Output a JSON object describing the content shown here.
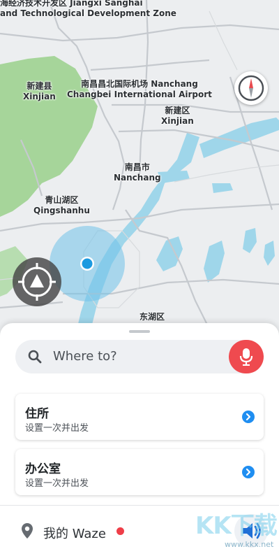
{
  "map": {
    "labels": {
      "zone_cn": "海经济技术开发区 Jiangxi Sanghai",
      "zone_en": "and Technological Development Zone",
      "xinjian_county_cn": "新建县",
      "xinjian_county_en": "Xinjian",
      "airport_cn": "南昌昌北国际机场 Nanchang",
      "airport_en": "Changbei International Airport",
      "xinjian_district_cn": "新建区",
      "xinjian_district_en": "Xinjian",
      "nanchang_cn": "南昌市",
      "nanchang_en": "Nanchang",
      "qingshanhu_cn": "青山湖区",
      "qingshanhu_en": "Qingshanhu",
      "donghu_cn": "东湖区"
    },
    "icons": {
      "compass": "compass-icon",
      "recenter": "recenter-icon"
    }
  },
  "sheet": {
    "search_placeholder": "Where to?",
    "cards": [
      {
        "title": "住所",
        "subtitle": "设置一次并出发"
      },
      {
        "title": "办公室",
        "subtitle": "设置一次并出发"
      }
    ]
  },
  "bottom": {
    "my_waze": "我的 Waze",
    "watermark": "KK下载",
    "watermark_url": "www.kkx.net"
  },
  "colors": {
    "accent_blue": "#1f8ef1",
    "mic_red": "#ef4a4f",
    "water": "#9fd6ea",
    "park_green": "#9bd08f"
  }
}
